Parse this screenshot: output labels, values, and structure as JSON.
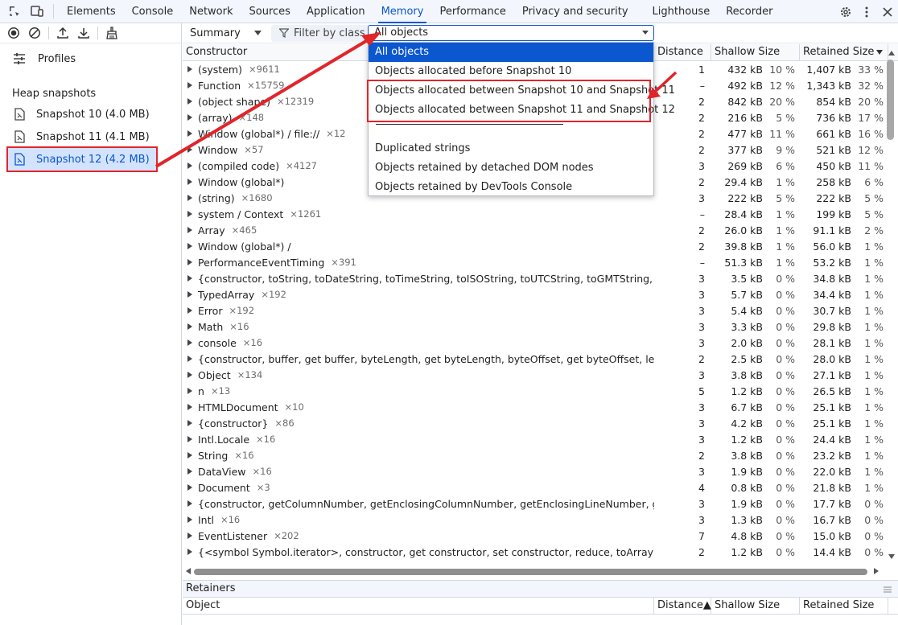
{
  "tabs": [
    "Elements",
    "Console",
    "Network",
    "Sources",
    "Application",
    "Memory",
    "Performance",
    "Privacy and security",
    "Lighthouse",
    "Recorder"
  ],
  "sidebar": {
    "profiles_label": "Profiles",
    "heap_title": "Heap snapshots",
    "snapshots": [
      "Snapshot 10 (4.0 MB)",
      "Snapshot 11 (4.1 MB)",
      "Snapshot 12 (4.2 MB)"
    ]
  },
  "toolbar": {
    "view": "Summary",
    "filter_placeholder": "Filter by class",
    "object_select": "All objects"
  },
  "dropdown": {
    "options": [
      "All objects",
      "Objects allocated before Snapshot 10",
      "Objects allocated between Snapshot 10 and Snapshot 11",
      "Objects allocated between Snapshot 11 and Snapshot 12"
    ],
    "separator": "————————————————",
    "extra": [
      "Duplicated strings",
      "Objects retained by detached DOM nodes",
      "Objects retained by DevTools Console"
    ]
  },
  "table": {
    "headers": [
      "Constructor",
      "Distance",
      "Shallow Size",
      "Retained Size"
    ],
    "rows": [
      {
        "name": "(system)",
        "count": "×9611",
        "dist": "1",
        "shallow": "432 kB",
        "sp": "10 %",
        "retained": "1,407 kB",
        "rp": "33 %"
      },
      {
        "name": "Function",
        "count": "×15759",
        "dist": "–",
        "shallow": "492 kB",
        "sp": "12 %",
        "retained": "1,343 kB",
        "rp": "32 %"
      },
      {
        "name": "(object shape)",
        "count": "×12319",
        "dist": "2",
        "shallow": "842 kB",
        "sp": "20 %",
        "retained": "854 kB",
        "rp": "20 %"
      },
      {
        "name": "(array)",
        "count": "×148",
        "dist": "2",
        "shallow": "216 kB",
        "sp": "5 %",
        "retained": "736 kB",
        "rp": "17 %"
      },
      {
        "name": "Window (global*) / file://",
        "count": "×12",
        "dist": "2",
        "shallow": "477 kB",
        "sp": "11 %",
        "retained": "661 kB",
        "rp": "16 %"
      },
      {
        "name": "Window",
        "count": "×57",
        "dist": "2",
        "shallow": "377 kB",
        "sp": "9 %",
        "retained": "521 kB",
        "rp": "12 %"
      },
      {
        "name": "(compiled code)",
        "count": "×4127",
        "dist": "3",
        "shallow": "269 kB",
        "sp": "6 %",
        "retained": "450 kB",
        "rp": "11 %"
      },
      {
        "name": "Window (global*)",
        "count": "",
        "dist": "2",
        "shallow": "29.4 kB",
        "sp": "1 %",
        "retained": "258 kB",
        "rp": "6 %"
      },
      {
        "name": "(string)",
        "count": "×1680",
        "dist": "3",
        "shallow": "222 kB",
        "sp": "5 %",
        "retained": "222 kB",
        "rp": "5 %"
      },
      {
        "name": "system / Context",
        "count": "×1261",
        "dist": "–",
        "shallow": "28.4 kB",
        "sp": "1 %",
        "retained": "199 kB",
        "rp": "5 %"
      },
      {
        "name": "Array",
        "count": "×465",
        "dist": "2",
        "shallow": "26.0 kB",
        "sp": "1 %",
        "retained": "91.1 kB",
        "rp": "2 %"
      },
      {
        "name": "Window (global*) /",
        "count": "",
        "dist": "2",
        "shallow": "39.8 kB",
        "sp": "1 %",
        "retained": "56.0 kB",
        "rp": "1 %"
      },
      {
        "name": "PerformanceEventTiming",
        "count": "×391",
        "dist": "–",
        "shallow": "51.3 kB",
        "sp": "1 %",
        "retained": "53.2 kB",
        "rp": "1 %"
      },
      {
        "name": "{constructor, toString, toDateString, toTimeString, toISOString, toUTCString, toGMTString, getDa...",
        "count": "",
        "dist": "3",
        "shallow": "3.5 kB",
        "sp": "0 %",
        "retained": "34.8 kB",
        "rp": "1 %"
      },
      {
        "name": "TypedArray",
        "count": "×192",
        "dist": "3",
        "shallow": "5.7 kB",
        "sp": "0 %",
        "retained": "34.4 kB",
        "rp": "1 %"
      },
      {
        "name": "Error",
        "count": "×192",
        "dist": "3",
        "shallow": "5.4 kB",
        "sp": "0 %",
        "retained": "30.7 kB",
        "rp": "1 %"
      },
      {
        "name": "Math",
        "count": "×16",
        "dist": "3",
        "shallow": "3.3 kB",
        "sp": "0 %",
        "retained": "29.8 kB",
        "rp": "1 %"
      },
      {
        "name": "console",
        "count": "×16",
        "dist": "3",
        "shallow": "2.0 kB",
        "sp": "0 %",
        "retained": "28.1 kB",
        "rp": "1 %"
      },
      {
        "name": "{constructor, buffer, get buffer, byteLength, get byteLength, byteOffset, get byteOffset, length, g...",
        "count": "",
        "dist": "2",
        "shallow": "2.5 kB",
        "sp": "0 %",
        "retained": "28.0 kB",
        "rp": "1 %"
      },
      {
        "name": "Object",
        "count": "×134",
        "dist": "3",
        "shallow": "3.8 kB",
        "sp": "0 %",
        "retained": "27.1 kB",
        "rp": "1 %"
      },
      {
        "name": "n",
        "count": "×13",
        "dist": "5",
        "shallow": "1.2 kB",
        "sp": "0 %",
        "retained": "26.5 kB",
        "rp": "1 %"
      },
      {
        "name": "HTMLDocument",
        "count": "×10",
        "dist": "3",
        "shallow": "6.7 kB",
        "sp": "0 %",
        "retained": "25.1 kB",
        "rp": "1 %"
      },
      {
        "name": "{constructor}",
        "count": "×86",
        "dist": "3",
        "shallow": "4.2 kB",
        "sp": "0 %",
        "retained": "25.1 kB",
        "rp": "1 %"
      },
      {
        "name": "Intl.Locale",
        "count": "×16",
        "dist": "3",
        "shallow": "1.2 kB",
        "sp": "0 %",
        "retained": "24.4 kB",
        "rp": "1 %"
      },
      {
        "name": "String",
        "count": "×16",
        "dist": "2",
        "shallow": "3.8 kB",
        "sp": "0 %",
        "retained": "23.2 kB",
        "rp": "1 %"
      },
      {
        "name": "DataView",
        "count": "×16",
        "dist": "3",
        "shallow": "1.9 kB",
        "sp": "0 %",
        "retained": "22.0 kB",
        "rp": "1 %"
      },
      {
        "name": "Document",
        "count": "×3",
        "dist": "4",
        "shallow": "0.8 kB",
        "sp": "0 %",
        "retained": "21.8 kB",
        "rp": "1 %"
      },
      {
        "name": "{constructor, getColumnNumber, getEnclosingColumnNumber, getEnclosingLineNumber, getEv...",
        "count": "",
        "dist": "3",
        "shallow": "1.9 kB",
        "sp": "0 %",
        "retained": "17.7 kB",
        "rp": "0 %"
      },
      {
        "name": "Intl",
        "count": "×16",
        "dist": "3",
        "shallow": "1.3 kB",
        "sp": "0 %",
        "retained": "16.7 kB",
        "rp": "0 %"
      },
      {
        "name": "EventListener",
        "count": "×202",
        "dist": "7",
        "shallow": "4.8 kB",
        "sp": "0 %",
        "retained": "15.0 kB",
        "rp": "0 %"
      },
      {
        "name": "{<symbol Symbol.iterator>, constructor, get constructor, set constructor, reduce, toArray, forEac...",
        "count": "",
        "dist": "2",
        "shallow": "1.2 kB",
        "sp": "0 %",
        "retained": "14.4 kB",
        "rp": "0 %"
      }
    ]
  },
  "retainers": {
    "title": "Retainers",
    "headers": [
      "Object",
      "Distance▲",
      "Shallow Size",
      "Retained Size"
    ]
  }
}
